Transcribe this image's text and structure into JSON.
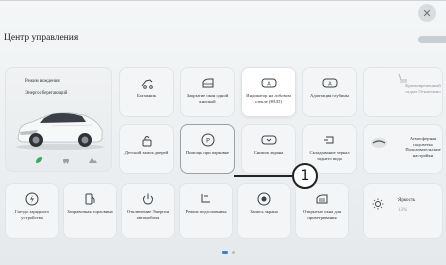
{
  "header": {
    "title": "Центр управления"
  },
  "drive_mode": {
    "label": "Режим вождения",
    "value": "Энергосберегающий",
    "modes": [
      "leaf-icon",
      "car-icon",
      "mountain-icon"
    ]
  },
  "row1": [
    {
      "label": "Багажник",
      "icon": "trunk-icon"
    },
    {
      "label": "Закрытие окон одной кнопкой",
      "icon": "window-icon"
    },
    {
      "label": "Индикатор на лобовом стекле (HUD)",
      "icon": "hud-icon"
    },
    {
      "label": "Адаптация глубины",
      "icon": "depth-icon"
    },
    {
      "label": "Кратковременный отдых Отключено",
      "icon": "seat-rest-icon"
    }
  ],
  "row2": [
    {
      "label": "Детский замок дверей",
      "icon": "child-lock-icon"
    },
    {
      "label": "Помощь при парковке",
      "icon": "parking-assist-icon"
    },
    {
      "label": "Снимок экрана",
      "icon": "screenshot-icon"
    },
    {
      "label": "Складывание зеркал заднего вида",
      "icon": "mirror-fold-icon"
    },
    {
      "label": "Атмосферная подсветка Пользовательские настройки",
      "icon": "ambient-light-icon"
    }
  ],
  "row3": [
    {
      "label": "Гнездо зарядного устройства",
      "icon": "charging-port-icon"
    },
    {
      "label": "Заправочная горловина",
      "icon": "fuel-icon"
    },
    {
      "label": "Отключение Энергии автомобиля",
      "icon": "power-icon"
    },
    {
      "label": "Режим подголовника",
      "icon": "headrest-icon"
    },
    {
      "label": "Запись экрана",
      "icon": "record-icon"
    },
    {
      "label": "Открытые окна для проветривания",
      "icon": "ventilation-icon"
    }
  ],
  "brightness": {
    "label": "Яркость",
    "value": "13%",
    "level": 0.13
  },
  "callout": {
    "number": "1"
  },
  "pager": {
    "pages": 2,
    "current": 1
  }
}
